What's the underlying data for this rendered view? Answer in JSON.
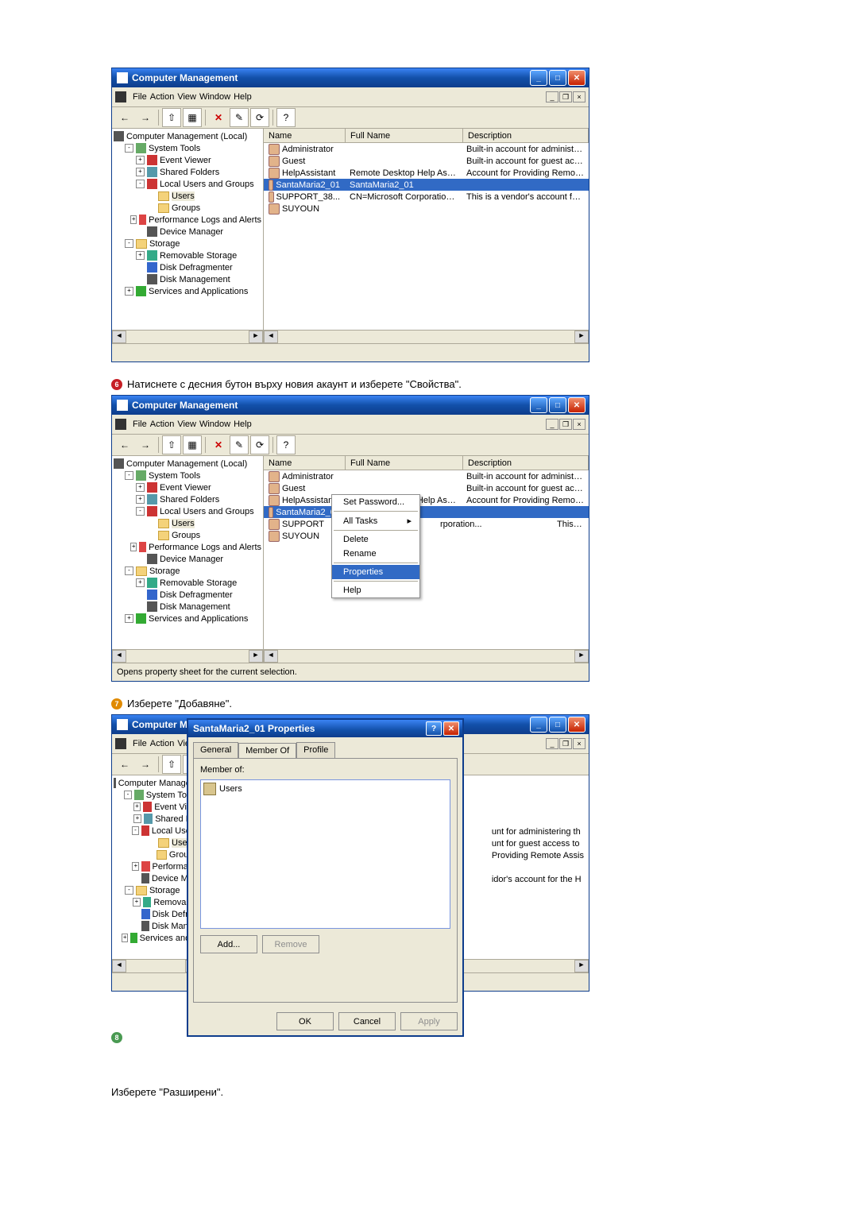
{
  "steps": {
    "s6": "Натиснете с десния бутон върху новия акаунт и изберете \"Свойства\".",
    "s7": "Изберете \"Добавяне\".",
    "s8_bottom": "Изберете \"Разширени\"."
  },
  "window": {
    "title": "Computer Management",
    "menus": [
      "File",
      "Action",
      "View",
      "Window",
      "Help"
    ]
  },
  "tree": {
    "root": "Computer Management (Local)",
    "systools": "System Tools",
    "evtviewer": "Event Viewer",
    "shared": "Shared Folders",
    "lug": "Local Users and Groups",
    "users": "Users",
    "groups": "Groups",
    "perf": "Performance Logs and Alerts",
    "devmgr": "Device Manager",
    "storage": "Storage",
    "removable": "Removable Storage",
    "defrag": "Disk Defragmenter",
    "diskm": "Disk Management",
    "services": "Services and Applications"
  },
  "list": {
    "cols": {
      "name": "Name",
      "full": "Full Name",
      "desc": "Description"
    },
    "rows": [
      {
        "name": "Administrator",
        "full": "",
        "desc": "Built-in account for administering th"
      },
      {
        "name": "Guest",
        "full": "",
        "desc": "Built-in account for guest access to"
      },
      {
        "name": "HelpAssistant",
        "full": "Remote Desktop Help Assi...",
        "desc": "Account for Providing Remote Assis"
      },
      {
        "name": "SantaMaria2_01",
        "full": "SantaMaria2_01",
        "desc": ""
      },
      {
        "name": "SUPPORT_38...",
        "full": "CN=Microsoft Corporation...",
        "desc": "This is a vendor's account for the H"
      },
      {
        "name": "SUYOUN",
        "full": "",
        "desc": ""
      }
    ],
    "rows2": {
      "support_short": "SUPPORT",
      "support_full2": "rporation...",
      "support_desc2": "This is a vendor's account for the H"
    }
  },
  "context_menu": {
    "setpass": "Set Password...",
    "alltasks": "All Tasks",
    "delete": "Delete",
    "rename": "Rename",
    "properties": "Properties",
    "help": "Help"
  },
  "status": {
    "opens_prop": "Opens property sheet for the current selection."
  },
  "dialog": {
    "title": "SantaMaria2_01 Properties",
    "tabs": {
      "general": "General",
      "memberof": "Member Of",
      "profile": "Profile"
    },
    "memberof_label": "Member of:",
    "group_users": "Users",
    "add": "Add...",
    "remove": "Remove",
    "ok": "OK",
    "cancel": "Cancel",
    "apply": "Apply"
  },
  "back_desc": {
    "l1": "unt for administering th",
    "l2": "unt for guest access to",
    "l3": "Providing Remote Assis",
    "l4": "idor's account for the H"
  },
  "tree_trunc": {
    "root": "Computer Managem",
    "evt": "Event View",
    "shared": "Shared Fol",
    "lug": "Local Users",
    "perf": "Performand",
    "dev": "Device Man",
    "rem": "Removable",
    "defrag": "Disk Defrag",
    "diskm": "Disk Manag",
    "serv": "Services and A"
  },
  "partial_title": "Computer Mana",
  "menus_trunc": {
    "view": "Vie"
  }
}
